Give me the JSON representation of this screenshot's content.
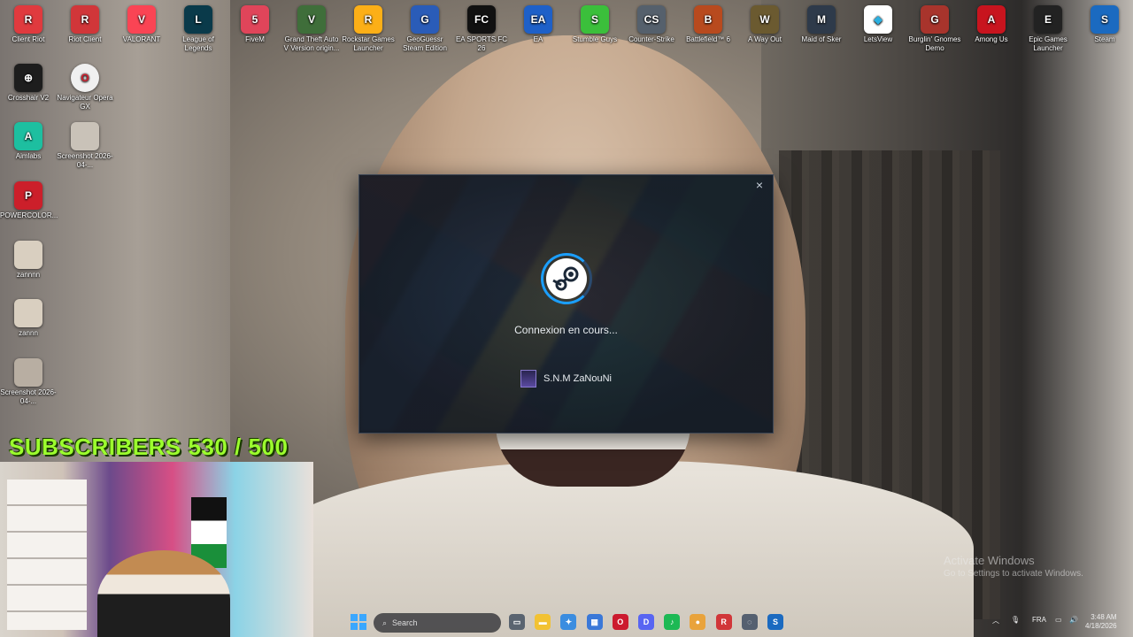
{
  "desktop": {
    "icons_top": [
      {
        "label": "Client Riot",
        "color": "#e03a3e",
        "glyph": "R"
      },
      {
        "label": "Riot Client",
        "color": "#d13639",
        "glyph": "R"
      },
      {
        "label": "VALORANT",
        "color": "#fa4454",
        "glyph": "V"
      },
      {
        "label": "League of Legends",
        "color": "#0a3a4a",
        "glyph": "L"
      },
      {
        "label": "FiveM",
        "color": "#e0455a",
        "glyph": "5"
      },
      {
        "label": "Grand Theft Auto V Version origin...",
        "color": "#3f6e3a",
        "glyph": "V"
      },
      {
        "label": "Rockstar Games Launcher",
        "color": "#fcaf17",
        "glyph": "R"
      },
      {
        "label": "GeoGuessr Steam Edition",
        "color": "#2a5cb8",
        "glyph": "G"
      },
      {
        "label": "EA SPORTS FC 26",
        "color": "#111111",
        "glyph": "FC"
      },
      {
        "label": "EA",
        "color": "#1e60c8",
        "glyph": "EA"
      },
      {
        "label": "Stumble Guys",
        "color": "#3bbf3b",
        "glyph": "S"
      },
      {
        "label": "Counter-Strike",
        "color": "#55606c",
        "glyph": "CS"
      },
      {
        "label": "Battlefield™ 6",
        "color": "#b84a1e",
        "glyph": "B"
      },
      {
        "label": "A Way Out",
        "color": "#6b5a30",
        "glyph": "W"
      },
      {
        "label": "Maid of Sker",
        "color": "#2e3a4a",
        "glyph": "M"
      },
      {
        "label": "LetsView",
        "color": "#ffffff",
        "glyph": "◆"
      },
      {
        "label": "Burglin' Gnomes Demo",
        "color": "#a8342c",
        "glyph": "G"
      },
      {
        "label": "Among Us",
        "color": "#c8141e",
        "glyph": "A"
      },
      {
        "label": "Epic Games Launcher",
        "color": "#222222",
        "glyph": "E"
      },
      {
        "label": "Steam",
        "color": "#1b6ac0",
        "glyph": "S"
      }
    ],
    "icons_left": [
      {
        "label": "Crosshair V2",
        "color": "#1d1d1d",
        "glyph": "⊕"
      },
      {
        "label": "Navigateur Opera GX",
        "color": "#f0f0f0",
        "glyph": "O"
      },
      {
        "label": "Aimlabs",
        "color": "#1dbfa0",
        "glyph": "A"
      },
      {
        "label": "Screenshot 2026-04-...",
        "color": "#c9c2b8",
        "glyph": ""
      },
      {
        "label": "POWERCOLOR...",
        "color": "#cc1f2a",
        "glyph": "P"
      },
      {
        "label": "zannnn",
        "color": "#d9cfc0",
        "glyph": ""
      },
      {
        "label": "zannn",
        "color": "#d9cfc0",
        "glyph": ""
      },
      {
        "label": "Screenshot 2026-04-...",
        "color": "#b8aea2",
        "glyph": ""
      }
    ]
  },
  "overlay": {
    "subscribers": "SUBSCRIBERS 530 / 500"
  },
  "steam_dialog": {
    "close": "×",
    "status": "Connexion en cours...",
    "username": "S.N.M ZaNouNi"
  },
  "watermark": {
    "title": "Activate Windows",
    "subtitle": "Go to Settings to activate Windows."
  },
  "taskbar": {
    "search_placeholder": "Search",
    "language": "FRA",
    "time": "3:48 AM",
    "date": "4/18/2026",
    "apps": [
      {
        "name": "task-view",
        "color": "#5a6470",
        "glyph": "▭"
      },
      {
        "name": "file-explorer",
        "color": "#f2c233",
        "glyph": "▬"
      },
      {
        "name": "copilot",
        "color": "#3b8de0",
        "glyph": "✦"
      },
      {
        "name": "microsoft-store",
        "color": "#3a78d8",
        "glyph": "▦"
      },
      {
        "name": "opera-gx",
        "color": "#cc1a2e",
        "glyph": "O"
      },
      {
        "name": "discord",
        "color": "#5865f2",
        "glyph": "D"
      },
      {
        "name": "spotify",
        "color": "#1db954",
        "glyph": "♪"
      },
      {
        "name": "chrome",
        "color": "#e9a33b",
        "glyph": "●"
      },
      {
        "name": "riot-client",
        "color": "#d13639",
        "glyph": "R"
      },
      {
        "name": "steam-loading",
        "color": "#556070",
        "glyph": "◌"
      },
      {
        "name": "steam",
        "color": "#1b6ac0",
        "glyph": "S"
      }
    ]
  }
}
